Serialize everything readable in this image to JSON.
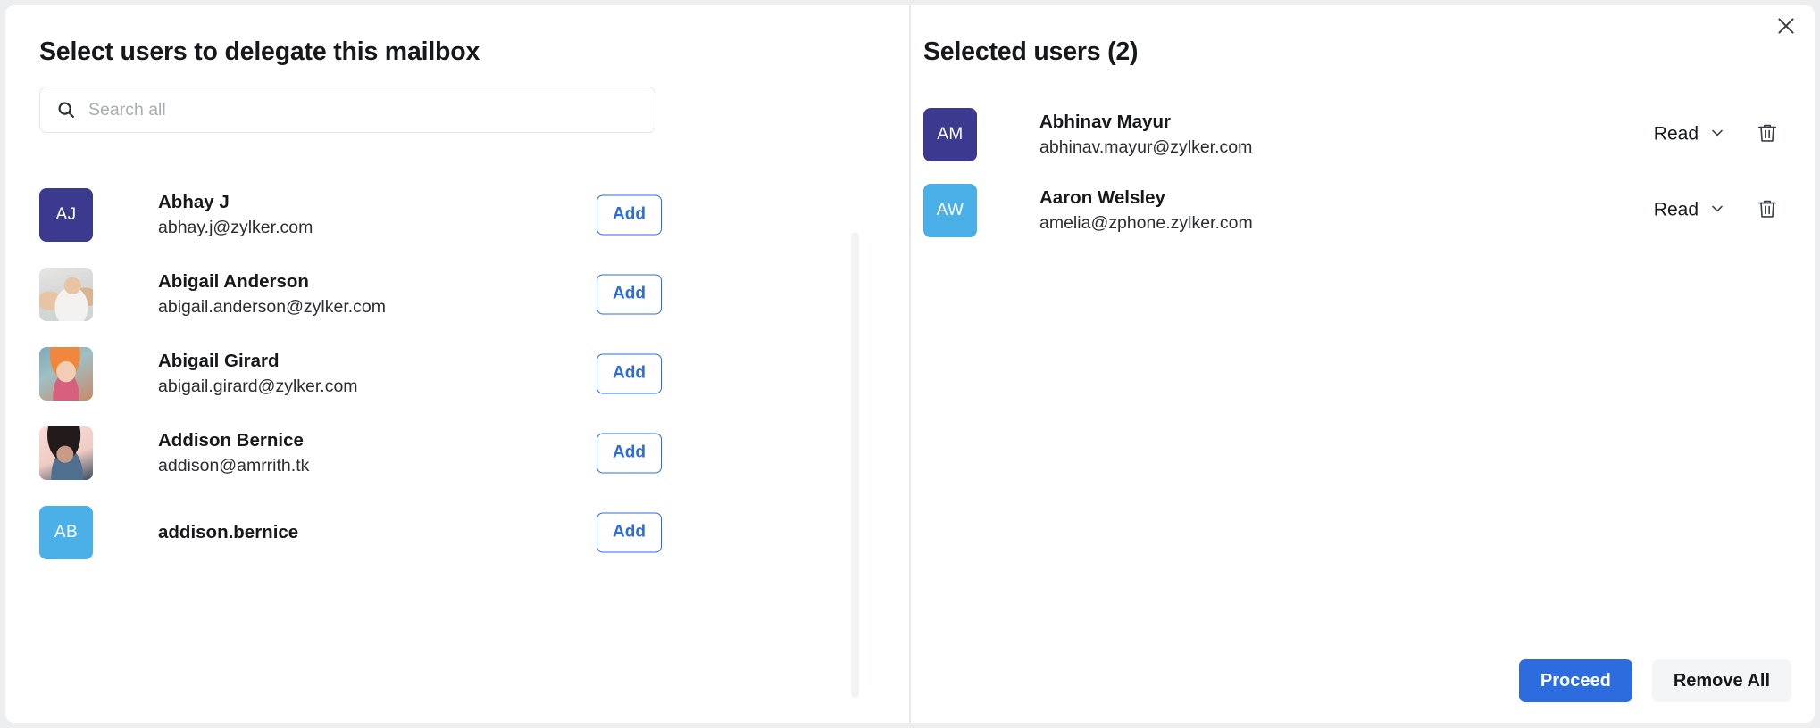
{
  "left": {
    "title": "Select users to delegate this mailbox",
    "search": {
      "placeholder": "Search all",
      "value": "",
      "icon": "search-icon"
    },
    "add_label": "Add",
    "users": [
      {
        "name": "Abhay J",
        "email": "abhay.j@zylker.com",
        "avatar_type": "initials",
        "initials": "AJ",
        "avatar_color": "#3b3a8e"
      },
      {
        "name": "Abigail Anderson",
        "email": "abigail.anderson@zylker.com",
        "avatar_type": "photo",
        "initials": "",
        "avatar_color": "#d9ccc0"
      },
      {
        "name": "Abigail Girard",
        "email": "abigail.girard@zylker.com",
        "avatar_type": "photo",
        "initials": "",
        "avatar_color": "#c98a6a"
      },
      {
        "name": "Addison Bernice",
        "email": "addison@amrrith.tk",
        "avatar_type": "photo",
        "initials": "",
        "avatar_color": "#f3d9d2"
      },
      {
        "name": "addison.bernice",
        "email": "",
        "avatar_type": "initials",
        "initials": "AB",
        "avatar_color": "#4bafe8"
      }
    ]
  },
  "right": {
    "title": "Selected users (2)",
    "close_icon": "close-icon",
    "chevron_icon": "chevron-down-icon",
    "delete_icon": "trash-icon",
    "selected": [
      {
        "name": "Abhinav Mayur",
        "email": "abhinav.mayur@zylker.com",
        "initials": "AM",
        "avatar_color": "#3b3a8e",
        "permission": "Read"
      },
      {
        "name": "Aaron Welsley",
        "email": "amelia@zphone.zylker.com",
        "initials": "AW",
        "avatar_color": "#4bafe8",
        "permission": "Read"
      }
    ],
    "footer": {
      "proceed_label": "Proceed",
      "remove_all_label": "Remove All"
    }
  },
  "colors": {
    "accent_blue": "#2d6cdf",
    "avatar_purple": "#3b3a8e",
    "avatar_blue": "#4bafe8",
    "page_background": "#eceef0"
  }
}
